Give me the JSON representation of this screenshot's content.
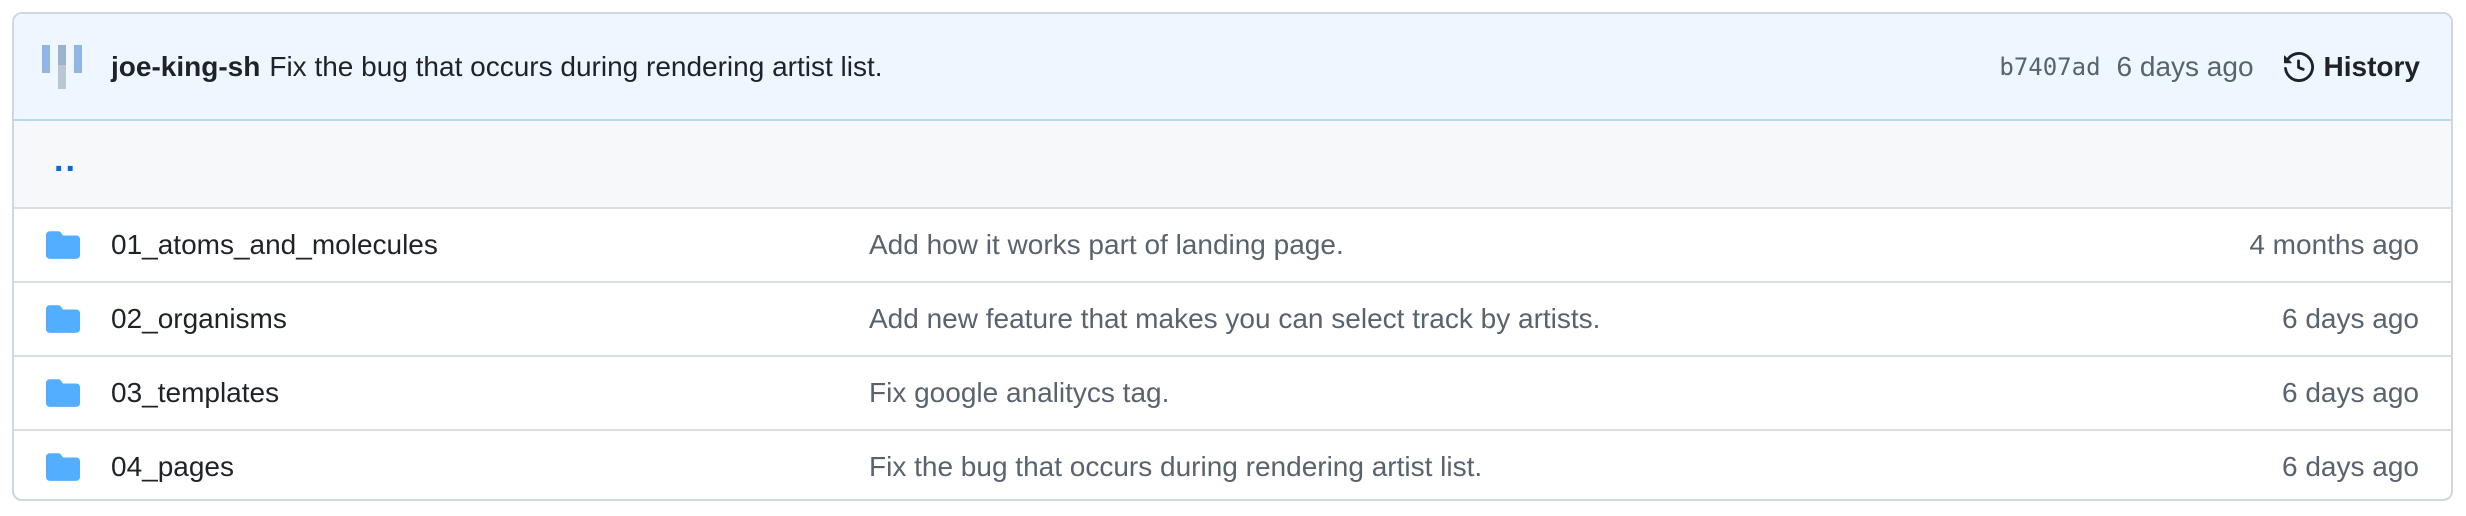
{
  "latest_commit": {
    "author": "joe-king-sh",
    "message": "Fix the bug that occurs during rendering artist list.",
    "sha": "b7407ad",
    "age": "6 days ago",
    "history_label": "History",
    "history_icon": "history-clock-icon",
    "avatar_icon": "identicon-avatar"
  },
  "parent_directory": {
    "label": ".."
  },
  "entries": [
    {
      "name": "01_atoms_and_molecules",
      "message": "Add how it works part of landing page.",
      "age": "4 months ago",
      "icon": "folder-icon"
    },
    {
      "name": "02_organisms",
      "message": "Add new feature that makes you can select track by artists.",
      "age": "6 days ago",
      "icon": "folder-icon"
    },
    {
      "name": "03_templates",
      "message": "Fix google analitycs tag.",
      "age": "6 days ago",
      "icon": "folder-icon"
    },
    {
      "name": "04_pages",
      "message": "Fix the bug that occurs during rendering artist list.",
      "age": "6 days ago",
      "icon": "folder-icon"
    }
  ],
  "colors": {
    "folder": "#54aeff",
    "link": "#0969da",
    "header_bg": "#eef6ff",
    "muted_text": "#59636e"
  }
}
